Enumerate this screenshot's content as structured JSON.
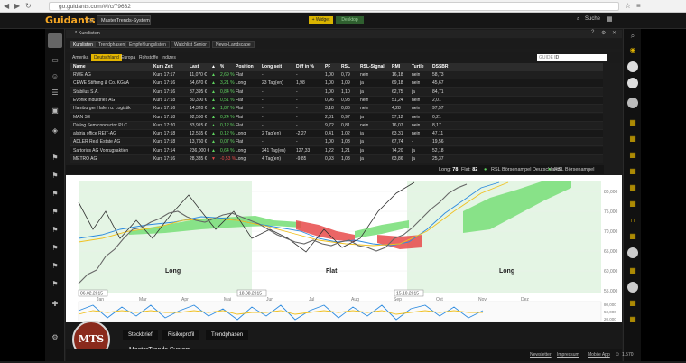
{
  "browser": {
    "url": "go.guidants.com/#!/c/79632"
  },
  "app": {
    "logo_main": "Guid",
    "logo_accent": "ants",
    "workspace_select": "MasterTrends-System",
    "btn_yellow": "+ Widget",
    "btn_green": "Desktop",
    "search_label": "Suche"
  },
  "window": {
    "title": "* Kurslisten"
  },
  "tabs": [
    "Kurslisten",
    "Trendphasen",
    "Empfehlungslisten",
    "Watchlist Senior",
    "News-Landscape"
  ],
  "subtabs": [
    "Amerika",
    "Deutschland",
    "Europa",
    "Rohstoffe",
    "Indizes"
  ],
  "search": {
    "label": "GUIDE",
    "value": "ID"
  },
  "table": {
    "headers": [
      "Name",
      "Kurs Zeit",
      "Last",
      "▲",
      "%",
      "Position",
      "Long seit",
      "Diff in %",
      "PF",
      "RSL",
      "RSL-Signal",
      "RMI",
      "Turtle",
      "DSSBR"
    ],
    "rows": [
      [
        "RWE AG",
        "Kurs 17:17",
        "11,070 €",
        "▲",
        "2,69 %",
        "Flat",
        "-",
        "-",
        "1,00",
        "0,79",
        "nein",
        "16,18",
        "nein",
        "58,73"
      ],
      [
        "CEWE Stiftung & Co. KGaA",
        "Kurs 17:16",
        "54,670 €",
        "▲",
        "3,21 %",
        "Long",
        "23 Tag(en)",
        "1,98",
        "1,00",
        "1,09",
        "ja",
        "69,18",
        "nein",
        "45,67"
      ],
      [
        "Stabilus S.A.",
        "Kurs 17:16",
        "37,395 €",
        "▲",
        "0,84 %",
        "Flat",
        "-",
        "-",
        "1,00",
        "1,10",
        "ja",
        "62,75",
        "ja",
        "84,71"
      ],
      [
        "Evonik Industries AG",
        "Kurs 17:18",
        "30,300 €",
        "▲",
        "0,51 %",
        "Flat",
        "-",
        "-",
        "0,96",
        "0,93",
        "nein",
        "51,24",
        "nein",
        "2,01"
      ],
      [
        "Hamburger Hafen u. Logistik",
        "Kurs 17:16",
        "14,320 €",
        "▲",
        "1,87 %",
        "Flat",
        "-",
        "-",
        "3,18",
        "0,86",
        "nein",
        "4,28",
        "nein",
        "97,57"
      ],
      [
        "MAN SE",
        "Kurs 17:18",
        "92,560 €",
        "▲",
        "0,24 %",
        "Flat",
        "-",
        "-",
        "2,31",
        "0,97",
        "ja",
        "57,12",
        "nein",
        "0,21"
      ],
      [
        "Dialog Semiconductor PLC",
        "Kurs 17:20",
        "33,915 €",
        "▲",
        "0,12 %",
        "Flat",
        "-",
        "-",
        "9,72",
        "0,81",
        "nein",
        "16,07",
        "nein",
        "8,17"
      ],
      [
        "alstria office REIT-AG",
        "Kurs 17:18",
        "12,565 €",
        "▲",
        "0,12 %",
        "Long",
        "2 Tag(en)",
        "-2,27",
        "0,41",
        "1,02",
        "ja",
        "63,31",
        "nein",
        "47,11"
      ],
      [
        "ADLER Real Estate AG",
        "Kurs 17:18",
        "13,760 €",
        "▲",
        "0,07 %",
        "Flat",
        "-",
        "-",
        "1,00",
        "1,03",
        "ja",
        "67,74",
        "-",
        "19,56"
      ],
      [
        "Sartorius AG Vorzugsaktien",
        "Kurs 17:14",
        "236,000 €",
        "▲",
        "0,64 %",
        "Long",
        "241 Tag(en)",
        "127,33",
        "1,22",
        "1,21",
        "ja",
        "74,20",
        "ja",
        "52,18"
      ],
      [
        "METRO AG",
        "Kurs 17:16",
        "28,385 €",
        "▼",
        "-0,53 %",
        "Long",
        "4 Tag(en)",
        "-9,85",
        "0,93",
        "1,03",
        "ja",
        "63,86",
        "ja",
        "25,37"
      ]
    ]
  },
  "status": {
    "long_label": "Long:",
    "long_value": "78",
    "flat_label": "Flat:",
    "flat_value": "82",
    "ampel_de": "RSL Börsenampel Deutschland",
    "ampel_us": "RSL Börsenampel USA"
  },
  "chart": {
    "phase_labels": [
      "Long",
      "Flat",
      "Long"
    ],
    "date_markers": [
      "06.02.2015",
      "18.08.2015",
      "15.10.2015"
    ],
    "x_labels": [
      "Jan",
      "Mar",
      "Apr",
      "Mai",
      "Jun",
      "Jul",
      "Aug",
      "Sep",
      "Okt",
      "Nov",
      "Dez"
    ],
    "y_labels": [
      "80,000",
      "75,000",
      "70,000",
      "65,000",
      "60,000",
      "55,000"
    ],
    "osc_labels": [
      "80,000",
      "50,000",
      "20,000"
    ],
    "colors": {
      "cloud_green": "#7de07d",
      "cloud_red": "#e84a4a",
      "phase_green": "#e4f5e4",
      "price": "#333333"
    }
  },
  "bottom_tabs": [
    "Steckbrief",
    "Risikoprofil",
    "Trendphasen"
  ],
  "brand": {
    "badge": "MTS",
    "name": "MasterTrends System"
  },
  "footer": {
    "links": [
      "Newsletter",
      "Impressum",
      "Mobile App"
    ],
    "counter": "1.570"
  }
}
